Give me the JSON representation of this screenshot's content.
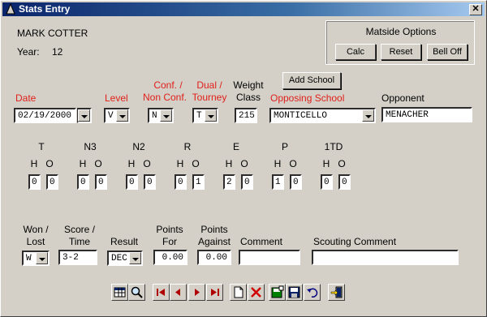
{
  "window": {
    "title": "Stats Entry"
  },
  "athlete": {
    "name": "MARK COTTER",
    "year_label": "Year:",
    "year_value": "12"
  },
  "matside": {
    "title": "Matside Options",
    "calc": "Calc",
    "reset": "Reset",
    "bell_off": "Bell Off"
  },
  "add_school": "Add School",
  "labels": {
    "date": "Date",
    "level": "Level",
    "conf_1": "Conf. /",
    "conf_2": "Non Conf.",
    "dual_1": "Dual /",
    "dual_2": "Tourney",
    "weight_1": "Weight",
    "weight_2": "Class",
    "opposing_school": "Opposing School",
    "opponent": "Opponent"
  },
  "values": {
    "date": "02/19/2000",
    "level": "V",
    "conf": "N",
    "dual": "T",
    "weight": "215",
    "opposing_school": "MONTICELLO",
    "opponent": "MENACHER"
  },
  "stats": [
    {
      "name": "T",
      "h": "0",
      "o": "0"
    },
    {
      "name": "N3",
      "h": "0",
      "o": "0"
    },
    {
      "name": "N2",
      "h": "0",
      "o": "0"
    },
    {
      "name": "R",
      "h": "0",
      "o": "1"
    },
    {
      "name": "E",
      "h": "2",
      "o": "0"
    },
    {
      "name": "P",
      "h": "1",
      "o": "0"
    },
    {
      "name": "1TD",
      "h": "0",
      "o": "0"
    }
  ],
  "ho": {
    "h": "H",
    "o": "O"
  },
  "result_labels": {
    "won_1": "Won /",
    "won_2": "Lost",
    "score_1": "Score /",
    "score_2": "Time",
    "result": "Result",
    "pf_1": "Points",
    "pf_2": "For",
    "pa_1": "Points",
    "pa_2": "Against",
    "comment": "Comment",
    "scouting": "Scouting Comment"
  },
  "result_values": {
    "won": "W",
    "score": "3-2",
    "result": "DEC",
    "pf": "0.00",
    "pa": "0.00",
    "comment": "",
    "scouting": ""
  }
}
